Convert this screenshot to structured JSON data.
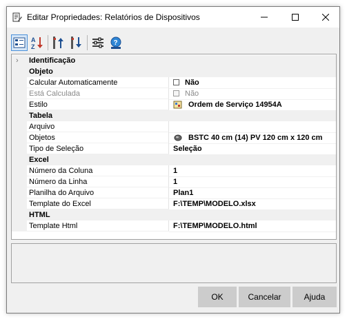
{
  "window": {
    "title": "Editar Propriedades: Relatórios de Dispositivos",
    "minimize": "—",
    "maximize": "☐",
    "close": "✕"
  },
  "toolbar": {
    "buttons": [
      {
        "name": "categorized-view",
        "active": true
      },
      {
        "name": "alphabetical-view",
        "active": false
      },
      {
        "name": "move-up",
        "active": false
      },
      {
        "name": "move-down",
        "active": false
      },
      {
        "name": "settings",
        "active": false
      },
      {
        "name": "help",
        "active": false
      }
    ]
  },
  "grid": {
    "rows": [
      {
        "type": "category",
        "label": "Identificação",
        "collapsed": true
      },
      {
        "type": "category",
        "label": "Objeto"
      },
      {
        "type": "property",
        "name": "Calcular Automaticamente",
        "value": "Não",
        "icon": "checkbox"
      },
      {
        "type": "property",
        "name": "Está Calculada",
        "value": "Não",
        "icon": "checkbox",
        "disabled": true
      },
      {
        "type": "property",
        "name": "Estilo",
        "value": "Ordem de Serviço 14954A",
        "icon": "style-icon"
      },
      {
        "type": "category",
        "label": "Tabela"
      },
      {
        "type": "property",
        "name": "Arquivo",
        "value": ""
      },
      {
        "type": "property",
        "name": "Objetos",
        "value": "BSTC 40 cm (14) PV 120 cm x 120 cm",
        "icon": "object-icon"
      },
      {
        "type": "property",
        "name": "Tipo de Seleção",
        "value": "Seleção"
      },
      {
        "type": "category",
        "label": "Excel"
      },
      {
        "type": "property",
        "name": "Número da Coluna",
        "value": "1"
      },
      {
        "type": "property",
        "name": "Número da Linha",
        "value": "1"
      },
      {
        "type": "property",
        "name": "Planilha do Arquivo",
        "value": "Plan1"
      },
      {
        "type": "property",
        "name": "Template do Excel",
        "value": "F:\\TEMP\\MODELO.xlsx"
      },
      {
        "type": "category",
        "label": "HTML"
      },
      {
        "type": "property",
        "name": "Template Html",
        "value": "F:\\TEMP\\MODELO.html"
      }
    ]
  },
  "buttons": {
    "ok": "OK",
    "cancel": "Cancelar",
    "help": "Ajuda"
  },
  "colors": {
    "window_bg": "#f0f0f0",
    "accent": "#4a90d9",
    "button_bg": "#cccccc"
  }
}
